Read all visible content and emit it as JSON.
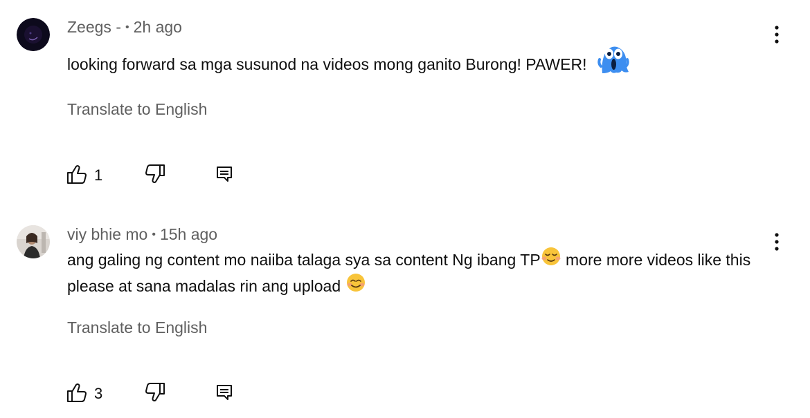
{
  "comments": [
    {
      "author": "Zeegs -",
      "time": "2h ago",
      "text": "looking forward sa mga susunod na videos mong ganito Burong! PAWER!",
      "translate_label": "Translate to English",
      "like_count": "1",
      "avatar_icon": "dark-avatar",
      "emoji_icon": "blue-screaming-sticker"
    },
    {
      "author": "viy bhie mo",
      "time": "15h ago",
      "text_part1": "ang galing ng content mo naiiba talaga sya sa content Ng ibang TP",
      "text_part2": " more more videos like this please at sana madalas rin ang upload ",
      "translate_label": "Translate to English",
      "like_count": "3",
      "avatar_icon": "photo-avatar",
      "emoji_icons": [
        "relieved-face-emoji",
        "smiling-face-emoji"
      ]
    }
  ],
  "colors": {
    "text_primary": "#0f0f0f",
    "text_secondary": "#606060",
    "sticker_blue": "#3d8ef0"
  },
  "icons": [
    "like-icon",
    "dislike-icon",
    "reply-icon",
    "more-vert-icon"
  ]
}
